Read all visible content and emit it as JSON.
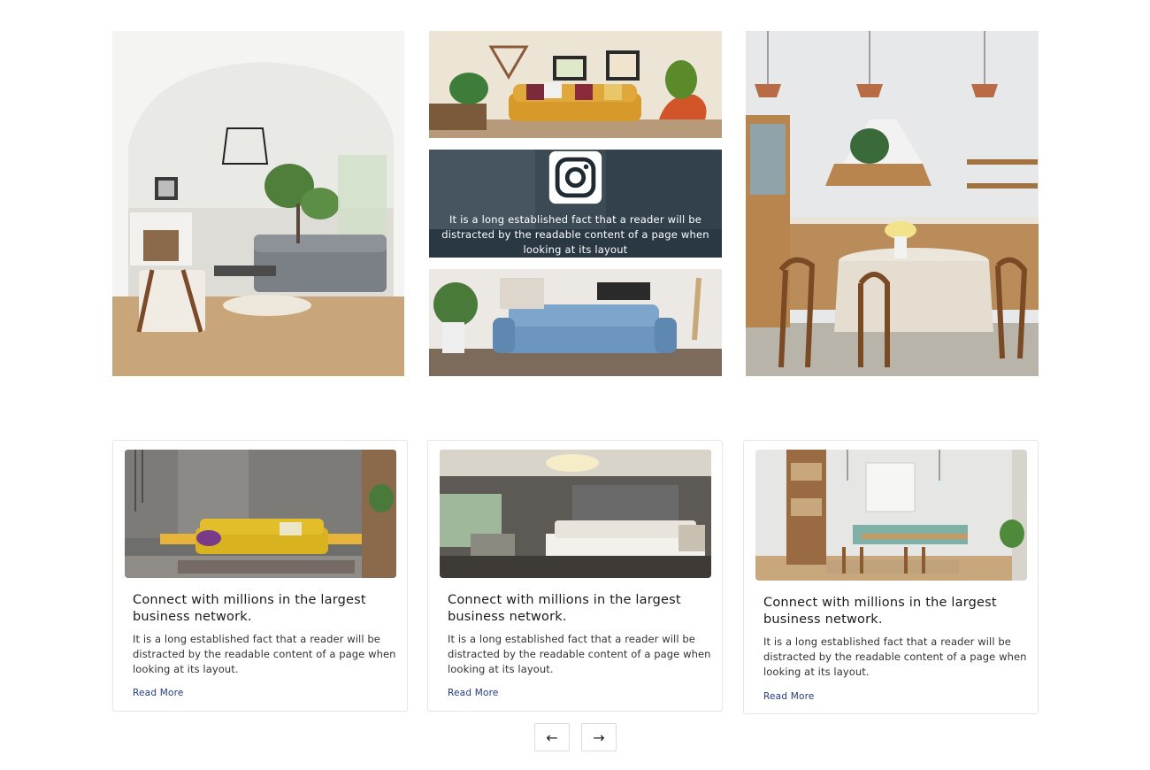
{
  "gallery": {
    "overlay": {
      "icon": "instagram-icon",
      "text": "It is a long established fact that a reader will be distracted by the readable content of a page when looking at its layout"
    }
  },
  "cards": [
    {
      "title": "Connect with millions in the largest business network.",
      "text": "It is a long established fact that a reader will be distracted by the readable content of a page when looking at its layout.",
      "link": "Read More"
    },
    {
      "title": "Connect with millions in the largest business network.",
      "text": "It is a long established fact that a reader will be distracted by the readable content of a page when looking at its layout.",
      "link": "Read More"
    },
    {
      "title": "Connect with millions in the largest business network.",
      "text": "It is a long established fact that a reader will be distracted by the readable content of a page when looking at its layout.",
      "link": "Read More"
    }
  ],
  "pager": {
    "prev_icon": "arrow-left-icon",
    "next_icon": "arrow-right-icon",
    "prev_label": "←",
    "next_label": "→"
  },
  "colors": {
    "link": "#1f3a8a",
    "border": "#e6e6e6",
    "overlay": "#1e2d3c"
  }
}
